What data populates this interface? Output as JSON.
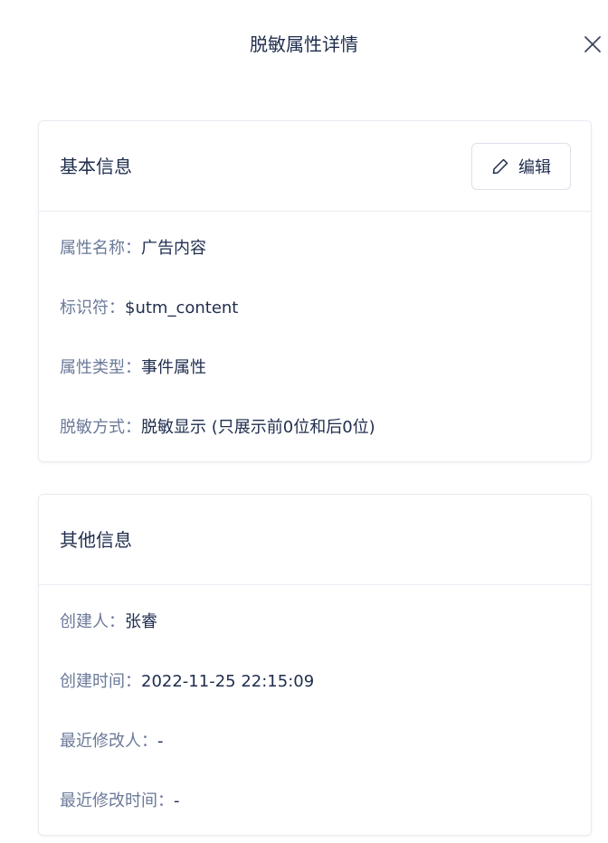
{
  "drawer": {
    "title": "脱敏属性详情"
  },
  "basic_info": {
    "title": "基本信息",
    "edit_label": "编辑",
    "fields": [
      {
        "label": "属性名称：",
        "value": "广告内容"
      },
      {
        "label": "标识符：",
        "value": "$utm_content"
      },
      {
        "label": "属性类型：",
        "value": "事件属性"
      },
      {
        "label": "脱敏方式：",
        "value": "脱敏显示 (只展示前0位和后0位)"
      }
    ]
  },
  "other_info": {
    "title": "其他信息",
    "fields": [
      {
        "label": "创建人：",
        "value": "张睿"
      },
      {
        "label": "创建时间：",
        "value": "2022-11-25 22:15:09"
      },
      {
        "label": "最近修改人：",
        "value": "-"
      },
      {
        "label": "最近修改时间：",
        "value": "-"
      }
    ]
  },
  "icons": {
    "close": "close-icon",
    "edit": "pencil-icon"
  },
  "colors": {
    "text_primary": "#1f2d4d",
    "text_label": "#6b7a99",
    "border": "#e8ebf1"
  }
}
